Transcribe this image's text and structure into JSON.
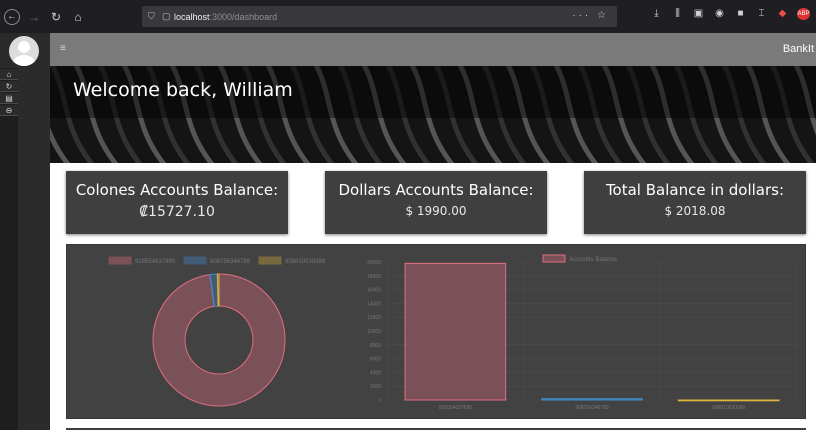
{
  "browser": {
    "url_host": "localhost",
    "url_path": ":3000/dashboard"
  },
  "app": {
    "brand": "BankIt",
    "welcome": "Welcome back, William"
  },
  "sidebar": {
    "items": [
      {
        "icon": "home-icon"
      },
      {
        "icon": "history-icon"
      },
      {
        "icon": "document-icon"
      },
      {
        "icon": "logout-icon"
      }
    ]
  },
  "cards": [
    {
      "title": "Colones Accounts Balance:",
      "value": "₡15727.10"
    },
    {
      "title": "Dollars Accounts Balance:",
      "value": "$ 1990.00"
    },
    {
      "title": "Total Balance in dollars:",
      "value": "$ 2018.08"
    }
  ],
  "colors": {
    "series": [
      "#e26d80",
      "#3f8fd4",
      "#e0b33c"
    ],
    "panel": "#424242"
  },
  "chart_data": [
    {
      "type": "pie",
      "categories": [
        "928554637890",
        "908756346789",
        "908810030088"
      ],
      "values": [
        97.8,
        1.8,
        0.4
      ],
      "legend": "top"
    },
    {
      "type": "bar",
      "categories": [
        "928554637890",
        "908756346789",
        "908810030088"
      ],
      "series": [
        {
          "name": "Accounts Balance",
          "values": [
            19800,
            190,
            0
          ]
        }
      ],
      "ylim": [
        0,
        20000
      ],
      "yticks": [
        0,
        2000,
        4000,
        6000,
        8000,
        10000,
        12000,
        14000,
        16000,
        18000,
        20000
      ],
      "grid": true,
      "legend": "top"
    }
  ]
}
